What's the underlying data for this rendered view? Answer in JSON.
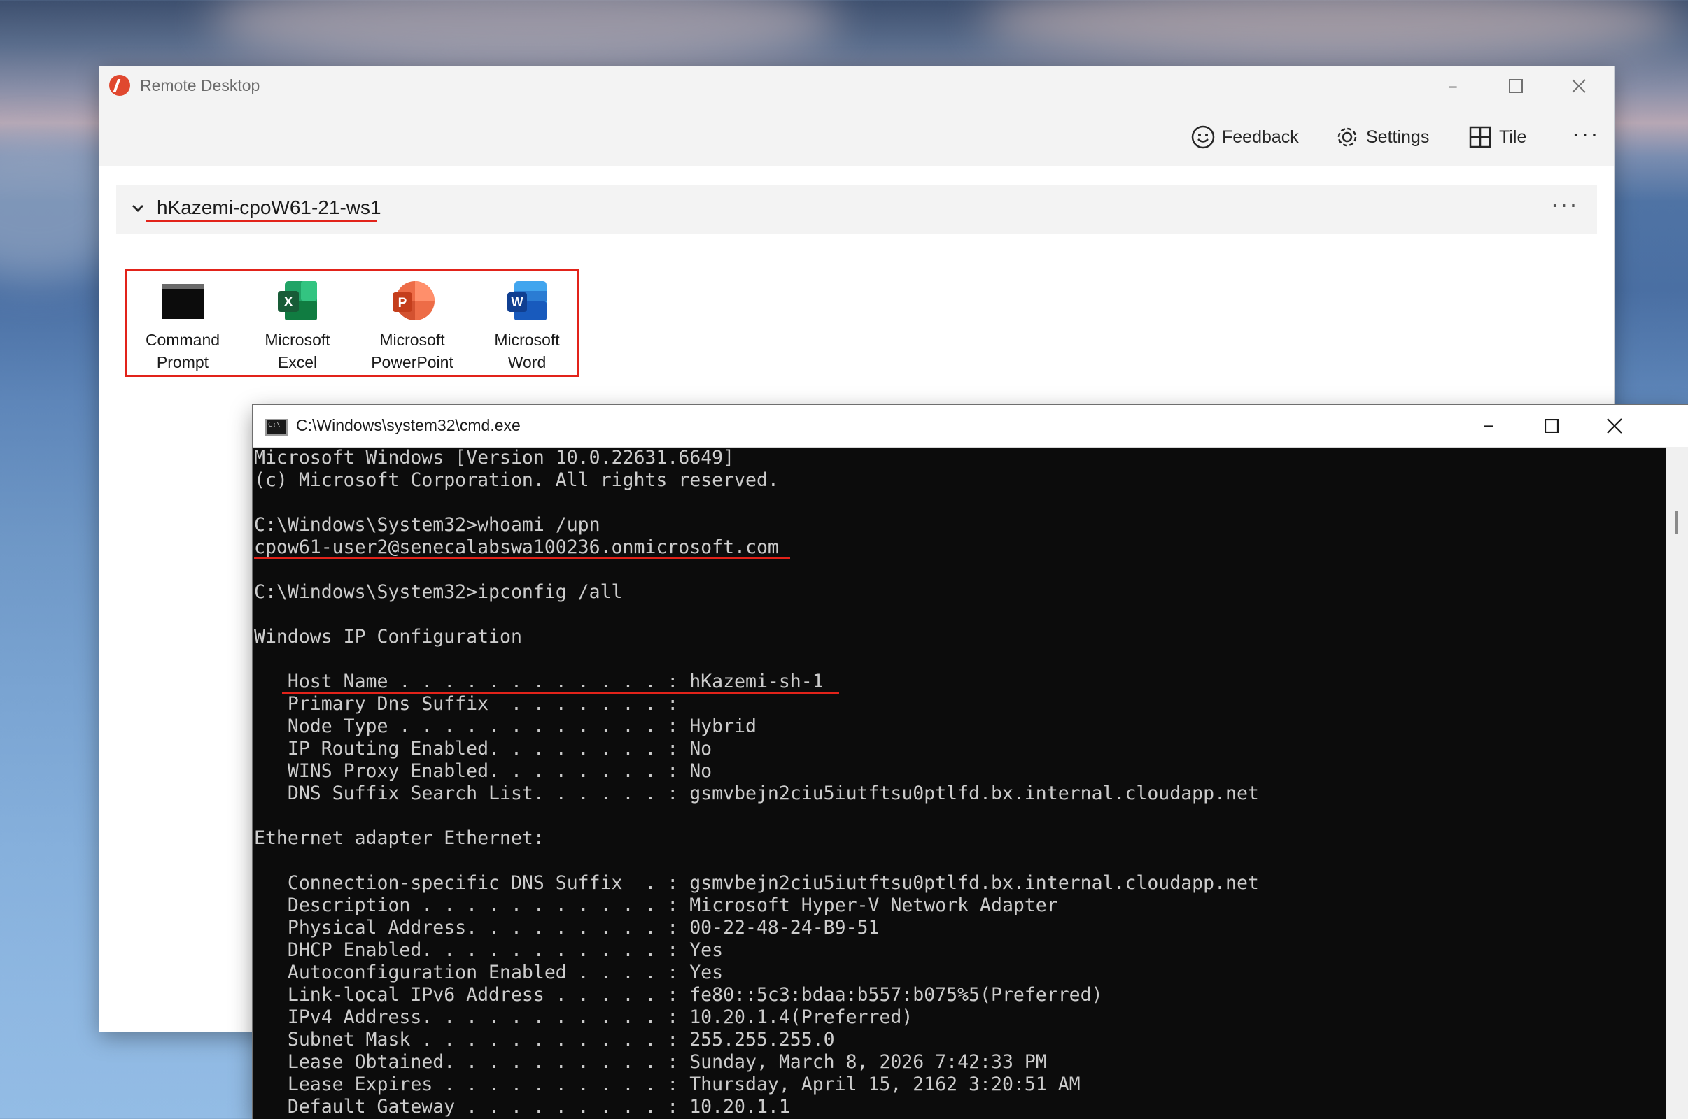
{
  "rd": {
    "title": "Remote Desktop",
    "toolbar": {
      "feedback": "Feedback",
      "settings": "Settings",
      "tile": "Tile",
      "more": "···"
    },
    "group_name": "hKazemi-cpoW61-21-ws1",
    "group_more": "···",
    "apps": [
      {
        "line1": "Command",
        "line2": "Prompt",
        "icon": "command-prompt-icon"
      },
      {
        "line1": "Microsoft",
        "line2": "Excel",
        "icon": "excel-icon"
      },
      {
        "line1": "Microsoft",
        "line2": "PowerPoint",
        "icon": "powerpoint-icon"
      },
      {
        "line1": "Microsoft",
        "line2": "Word",
        "icon": "word-icon"
      }
    ]
  },
  "cmd": {
    "title": "C:\\Windows\\system32\\cmd.exe",
    "lines": [
      "Microsoft Windows [Version 10.0.22631.6649]",
      "(c) Microsoft Corporation. All rights reserved.",
      "",
      "C:\\Windows\\System32>whoami /upn",
      "cpow61-user2@senecalabswa100236.onmicrosoft.com",
      "",
      "C:\\Windows\\System32>ipconfig /all",
      "",
      "Windows IP Configuration",
      "",
      "   Host Name . . . . . . . . . . . . : hKazemi-sh-1",
      "   Primary Dns Suffix  . . . . . . . :",
      "   Node Type . . . . . . . . . . . . : Hybrid",
      "   IP Routing Enabled. . . . . . . . : No",
      "   WINS Proxy Enabled. . . . . . . . : No",
      "   DNS Suffix Search List. . . . . . : gsmvbejn2ciu5iutftsu0ptlfd.bx.internal.cloudapp.net",
      "",
      "Ethernet adapter Ethernet:",
      "",
      "   Connection-specific DNS Suffix  . : gsmvbejn2ciu5iutftsu0ptlfd.bx.internal.cloudapp.net",
      "   Description . . . . . . . . . . . : Microsoft Hyper-V Network Adapter",
      "   Physical Address. . . . . . . . . : 00-22-48-24-B9-51",
      "   DHCP Enabled. . . . . . . . . . . : Yes",
      "   Autoconfiguration Enabled . . . . : Yes",
      "   Link-local IPv6 Address . . . . . : fe80::5c3:bdaa:b557:b075%5(Preferred)",
      "   IPv4 Address. . . . . . . . . . . : 10.20.1.4(Preferred)",
      "   Subnet Mask . . . . . . . . . . . : 255.255.255.0",
      "   Lease Obtained. . . . . . . . . . : Sunday, March 8, 2026 7:42:33 PM",
      "   Lease Expires . . . . . . . . . . : Thursday, April 15, 2162 3:20:51 AM",
      "   Default Gateway . . . . . . . . . : 10.20.1.1"
    ]
  },
  "colors": {
    "annotation_red": "#e2231a",
    "terminal_bg": "#0c0c0c",
    "terminal_fg": "#cccccc"
  }
}
